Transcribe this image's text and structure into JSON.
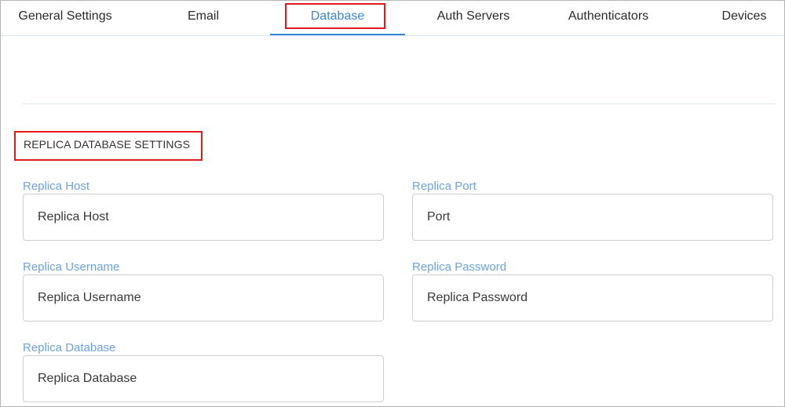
{
  "tabs": [
    {
      "label": "General Settings",
      "active": false
    },
    {
      "label": "Email",
      "active": false
    },
    {
      "label": "Database",
      "active": true
    },
    {
      "label": "Auth Servers",
      "active": false
    },
    {
      "label": "Authenticators",
      "active": false
    },
    {
      "label": "Devices",
      "active": false
    }
  ],
  "section": {
    "title": "REPLICA DATABASE SETTINGS"
  },
  "fields": {
    "replica_host": {
      "label": "Replica Host",
      "placeholder": "Replica Host",
      "value": ""
    },
    "replica_port": {
      "label": "Replica Port",
      "placeholder": "Port",
      "value": ""
    },
    "replica_username": {
      "label": "Replica Username",
      "placeholder": "Replica Username",
      "value": ""
    },
    "replica_password": {
      "label": "Replica Password",
      "placeholder": "Replica Password",
      "value": ""
    },
    "replica_database": {
      "label": "Replica Database",
      "placeholder": "Replica Database",
      "value": ""
    }
  },
  "colors": {
    "accent": "#3b86d6",
    "label": "#6aa3e8",
    "highlight": "#e01b1b"
  }
}
